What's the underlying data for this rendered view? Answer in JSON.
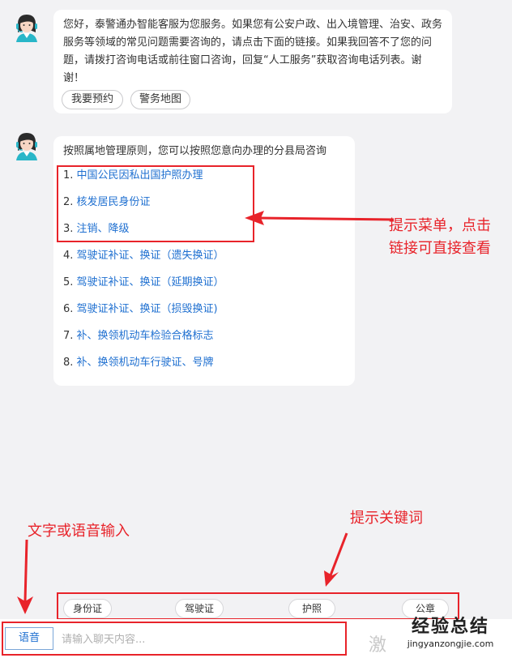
{
  "messages": {
    "welcome": {
      "text": "您好，泰警通办智能客服为您服务。如果您有公安户政、出入境管理、治安、政务服务等领域的常见问题需要咨询的，请点击下面的链接。如果我回答不了您的问题，请拨打咨询电话或前往窗口咨询，回复“人工服务”获取咨询电话列表。谢谢！",
      "buttons": [
        "我要预约",
        "警务地图"
      ]
    },
    "menu": {
      "intro": "按照属地管理原则，您可以按照您意向办理的分县局咨询",
      "items": [
        {
          "num": "1.",
          "label": "中国公民因私出国护照办理"
        },
        {
          "num": "2.",
          "label": "核发居民身份证"
        },
        {
          "num": "3.",
          "label": "注销、降级"
        },
        {
          "num": "4.",
          "label": "驾驶证补证、换证（遗失换证）"
        },
        {
          "num": "5.",
          "label": "驾驶证补证、换证（延期换证）"
        },
        {
          "num": "6.",
          "label": "驾驶证补证、换证（损毁换证)"
        },
        {
          "num": "7.",
          "label": "补、换领机动车检验合格标志"
        },
        {
          "num": "8.",
          "label": "补、换领机动车行驶证、号牌"
        }
      ]
    }
  },
  "keywords": [
    "身份证",
    "驾驶证",
    "护照",
    "公章"
  ],
  "input": {
    "voice_label": "语音",
    "placeholder": "请输入聊天内容..."
  },
  "annotations": {
    "menu_hint_line1": "提示菜单，点击",
    "menu_hint_line2": "链接可直接查看",
    "keyword_hint": "提示关键词",
    "input_hint": "文字或语音输入"
  },
  "watermark": {
    "text": "经验总结",
    "url": "jingyanzongjie.com",
    "partial_right": "激"
  },
  "colors": {
    "annotation": "#e8232a",
    "link": "#1e6fd0",
    "background": "#f2f2f4"
  }
}
